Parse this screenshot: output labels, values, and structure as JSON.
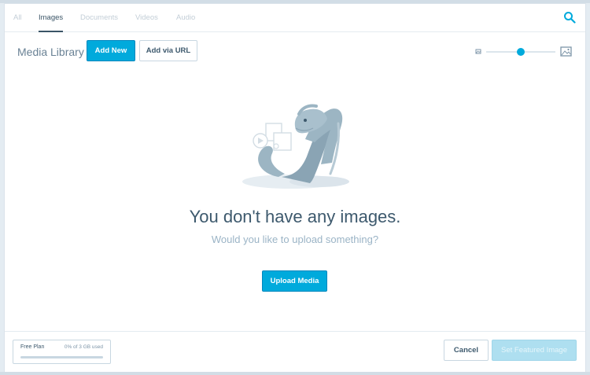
{
  "tabs": [
    {
      "label": "All",
      "active": false
    },
    {
      "label": "Images",
      "active": true
    },
    {
      "label": "Documents",
      "active": false
    },
    {
      "label": "Videos",
      "active": false
    },
    {
      "label": "Audio",
      "active": false
    }
  ],
  "header": {
    "title": "Media Library",
    "add_new_label": "Add New",
    "add_via_url_label": "Add via URL"
  },
  "size_slider": {
    "value": 0.5
  },
  "empty_state": {
    "title": "You don't have any images.",
    "subtitle": "Would you like to upload something?",
    "upload_label": "Upload Media"
  },
  "footer": {
    "plan_label": "Free Plan",
    "usage_text": "0% of 3 GB used",
    "usage_fraction": 0,
    "cancel_label": "Cancel",
    "set_featured_label": "Set Featured Image"
  },
  "colors": {
    "accent": "#00aadc",
    "text_dark": "#3d596d",
    "text_muted": "#9bb4c6"
  },
  "icons": [
    "search-icon",
    "small-image-icon",
    "large-image-icon",
    "sea-monster-illustration"
  ]
}
